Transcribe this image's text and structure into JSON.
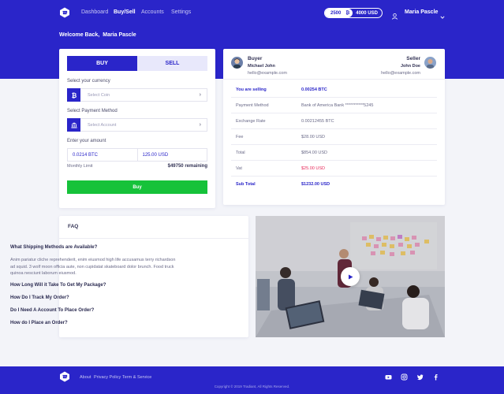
{
  "nav": {
    "links": [
      "Dashboard",
      "Buy/Sell",
      "Accounts",
      "Settings"
    ],
    "balance_btc": "2500",
    "balance_usd": "4000 USD",
    "user_name": "Maria Pascle"
  },
  "welcome": {
    "prefix": "Welcome Back,",
    "name": "Maria Pascle"
  },
  "trade": {
    "tab_buy": "BUY",
    "tab_sell": "SELL",
    "currency_label": "Select your currency",
    "coin_placeholder": "Select Coin",
    "payment_label": "Select Payment Method",
    "account_placeholder": "Select Account",
    "amount_label": "Enter your amount",
    "amount_btc": "0.0214 BTC",
    "amount_usd": "125.00 USD",
    "limit_label": "Monthly Limit",
    "limit_value": "$49750 remaining",
    "buy_button": "Buy"
  },
  "transaction": {
    "buyer": {
      "role": "Buyer",
      "name": "Michael John",
      "email": "hello@example.com"
    },
    "seller": {
      "role": "Seller",
      "name": "John Doe",
      "email": "hello@example.com"
    },
    "rows": [
      {
        "key": "You are selling",
        "value": "0.00254 BTC"
      },
      {
        "key": "Payment Method",
        "value": "Bank of America Bank ***********5245"
      },
      {
        "key": "Exchange Rate",
        "value": "0.00212455 BTC"
      },
      {
        "key": "Fee",
        "value": "$28.00 USD"
      },
      {
        "key": "Total",
        "value": "$854.00 USD"
      },
      {
        "key": "Vat",
        "value": "$25.00 USD"
      },
      {
        "key": "Sub Total",
        "value": "$1232.00 USD"
      }
    ]
  },
  "faq": {
    "title": "FAQ",
    "questions": [
      "What Shipping Methods are Available?",
      "How Long Will it Take To Get My Package?",
      "How Do I Track My Order?",
      "Do I Need A Account To Place Order?",
      "How do I Place an Order?"
    ],
    "answer": "Anim pariatur cliche reprehenderit, enim eiusmod high life accusamus terry richardson ad squid. 3 wolf moon officia aute, non cupidatat skateboard dolor brunch. Food truck quinoa nesciunt laborum eiusmod."
  },
  "footer": {
    "links": [
      "About",
      "Privacy Policy",
      "Term & Service"
    ],
    "copyright": "Copyright © 2019 Tradiant, All Rights Reserved."
  },
  "colors": {
    "primary": "#2a25c9",
    "success": "#16c23a",
    "danger": "#e82a5a"
  },
  "icons": [
    "logo-icon",
    "bitcoin-icon",
    "user-icon",
    "chevron-down-icon",
    "bank-icon",
    "play-icon",
    "youtube-icon",
    "instagram-icon",
    "twitter-icon",
    "facebook-icon"
  ]
}
